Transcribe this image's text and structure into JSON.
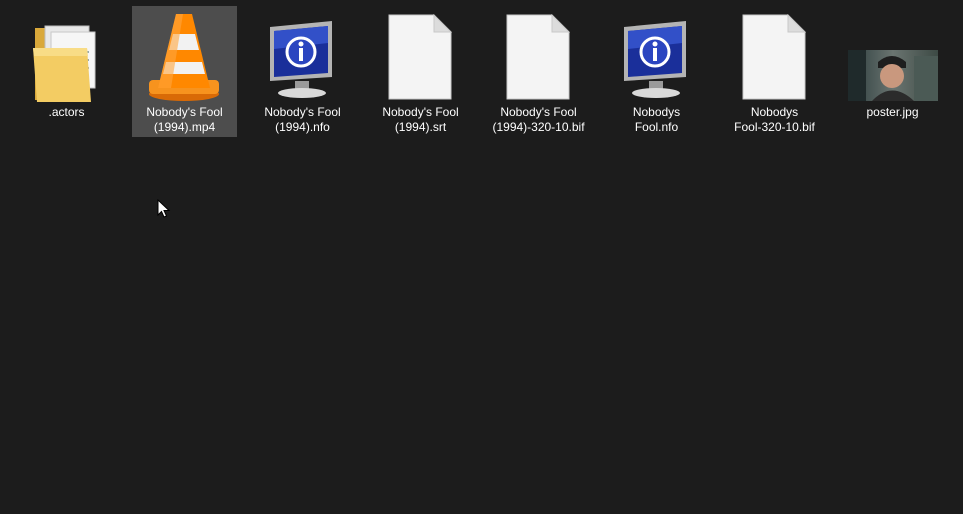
{
  "files": [
    {
      "name": ".actors",
      "type": "folder",
      "icon": "folder-icon"
    },
    {
      "name": "Nobody's Fool\n(1994).mp4",
      "type": "video",
      "icon": "vlc-cone-icon",
      "selected": true
    },
    {
      "name": "Nobody's Fool\n(1994).nfo",
      "type": "nfo",
      "icon": "info-monitor-icon"
    },
    {
      "name": "Nobody's Fool\n(1994).srt",
      "type": "generic",
      "icon": "blank-file-icon"
    },
    {
      "name": "Nobody's Fool\n(1994)-320-10.bif",
      "type": "generic",
      "icon": "blank-file-icon"
    },
    {
      "name": "Nobodys\nFool.nfo",
      "type": "nfo",
      "icon": "info-monitor-icon"
    },
    {
      "name": "Nobodys\nFool-320-10.bif",
      "type": "generic",
      "icon": "blank-file-icon"
    },
    {
      "name": "poster.jpg",
      "type": "image",
      "icon": "image-thumbnail-icon"
    }
  ],
  "colors": {
    "background": "#1c1c1c",
    "selection": "#4d4d4d",
    "text": "#ffffff"
  }
}
